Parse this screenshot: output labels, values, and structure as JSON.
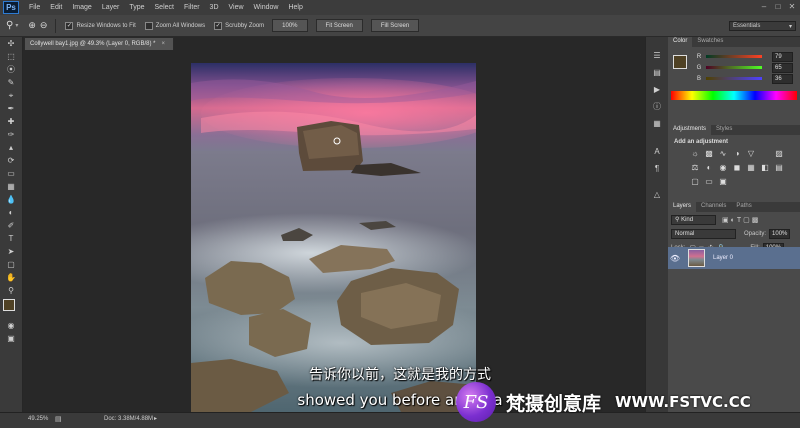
{
  "app": {
    "logo": "Ps",
    "menus": [
      "File",
      "Edit",
      "Image",
      "Layer",
      "Type",
      "Select",
      "Filter",
      "3D",
      "View",
      "Window",
      "Help"
    ]
  },
  "options": {
    "zoom_in_icon": "zoom-in-icon",
    "zoom_out_icon": "zoom-out-icon",
    "resize_windows": "Resize Windows to Fit",
    "zoom_all": "Zoom All Windows",
    "scrubby": "Scrubby Zoom",
    "pct100": "100%",
    "fit": "Fit Screen",
    "fill": "Fill Screen",
    "workspace": "Essentials"
  },
  "document": {
    "tab": "Collywell bay1.jpg @ 49.3% (Layer 0, RGB/8) *"
  },
  "status": {
    "zoom": "49.25%",
    "doc": "Doc: 3.38M/4.88M"
  },
  "color_panel": {
    "tabs": [
      "Color",
      "Swatches"
    ],
    "channels": [
      {
        "label": "R",
        "value": "79"
      },
      {
        "label": "G",
        "value": "65"
      },
      {
        "label": "B",
        "value": "36"
      }
    ],
    "fg_color": "#4f4124",
    "bg_color": "#ffffff"
  },
  "adjustments_panel": {
    "tabs": [
      "Adjustments",
      "Styles"
    ],
    "heading": "Add an adjustment"
  },
  "layers_panel": {
    "tabs": [
      "Layers",
      "Channels",
      "Paths"
    ],
    "filter": "Kind",
    "blend": "Normal",
    "opacity_label": "Opacity:",
    "opacity": "100%",
    "lock_label": "Lock:",
    "fill_label": "Fill:",
    "fill": "100%",
    "layer_name": "Layer 0"
  },
  "subtitles": {
    "chinese": "告诉你以前，这就是我的方式",
    "english": "showed you before and tha"
  },
  "watermark": {
    "logo": "FS",
    "chinese": "梵摄创意库",
    "url": "WWW.FSTVC.CC"
  }
}
